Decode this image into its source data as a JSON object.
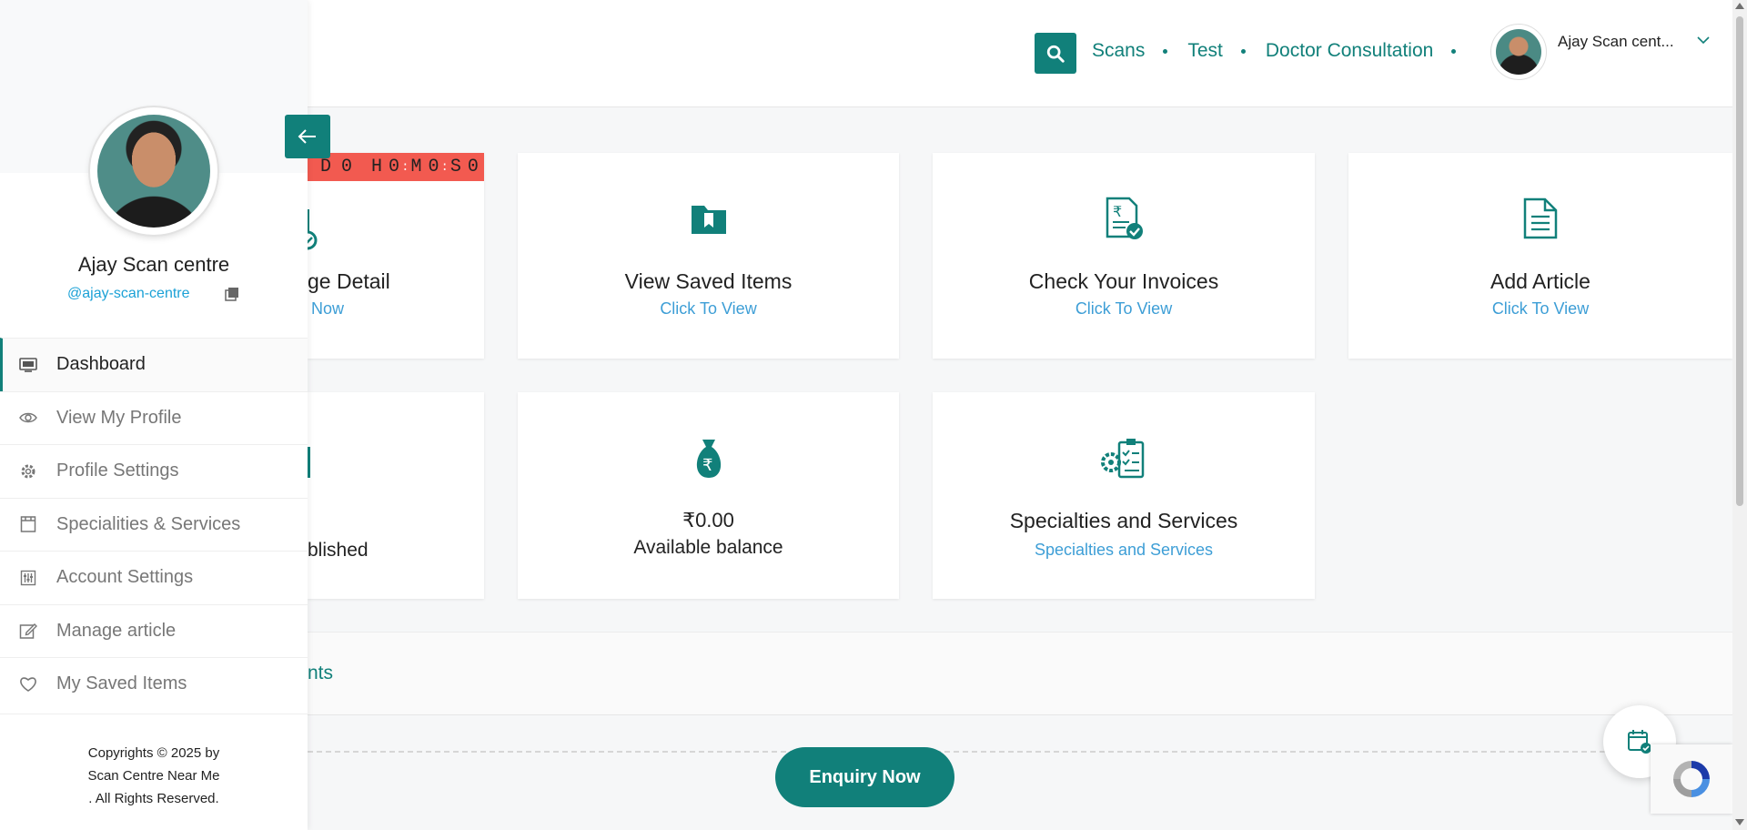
{
  "colors": {
    "accent": "#11807a",
    "link_blue": "#3d9ed6",
    "timer_red": "#f25a50",
    "handle_blue": "#1ba1d6"
  },
  "header": {
    "nav": [
      "Scans",
      "Test",
      "Doctor Consultation"
    ],
    "user_name": "Ajay Scan cent..."
  },
  "sidebar": {
    "name": "Ajay Scan centre",
    "handle": "@ajay-scan-centre",
    "items": [
      {
        "label": "Dashboard",
        "icon": "monitor-icon"
      },
      {
        "label": "View My Profile",
        "icon": "eye-icon"
      },
      {
        "label": "Profile Settings",
        "icon": "gear-icon"
      },
      {
        "label": "Specialities & Services",
        "icon": "calendar-page-icon"
      },
      {
        "label": "Account Settings",
        "icon": "sliders-icon"
      },
      {
        "label": "Manage article",
        "icon": "edit-icon"
      },
      {
        "label": "My Saved Items",
        "icon": "heart-icon"
      }
    ],
    "footer": [
      "Copyrights © 2025 by",
      "Scan Centre Near Me",
      ". All Rights Reserved."
    ]
  },
  "timer": {
    "d": "D",
    "dv": "0",
    "h": "H",
    "hv": "0",
    "m": "M",
    "mv": "0",
    "s": "S",
    "sv": "0"
  },
  "cards": {
    "package": {
      "title": "ge Detail",
      "sub": "Now"
    },
    "saved": {
      "title": "View Saved Items",
      "sub": "Click To View"
    },
    "invoices": {
      "title": "Check Your Invoices",
      "sub": "Click To View"
    },
    "article": {
      "title": "Add Article",
      "sub": "Click To View"
    },
    "published": {
      "title": "blished"
    },
    "balance": {
      "amount": "₹0.00",
      "label": "Available balance"
    },
    "specialties": {
      "title": "Specialties and Services",
      "sub": "Specialties and Services"
    }
  },
  "lower": {
    "appointments_label": "nts"
  },
  "enquiry_button": "Enquiry Now"
}
